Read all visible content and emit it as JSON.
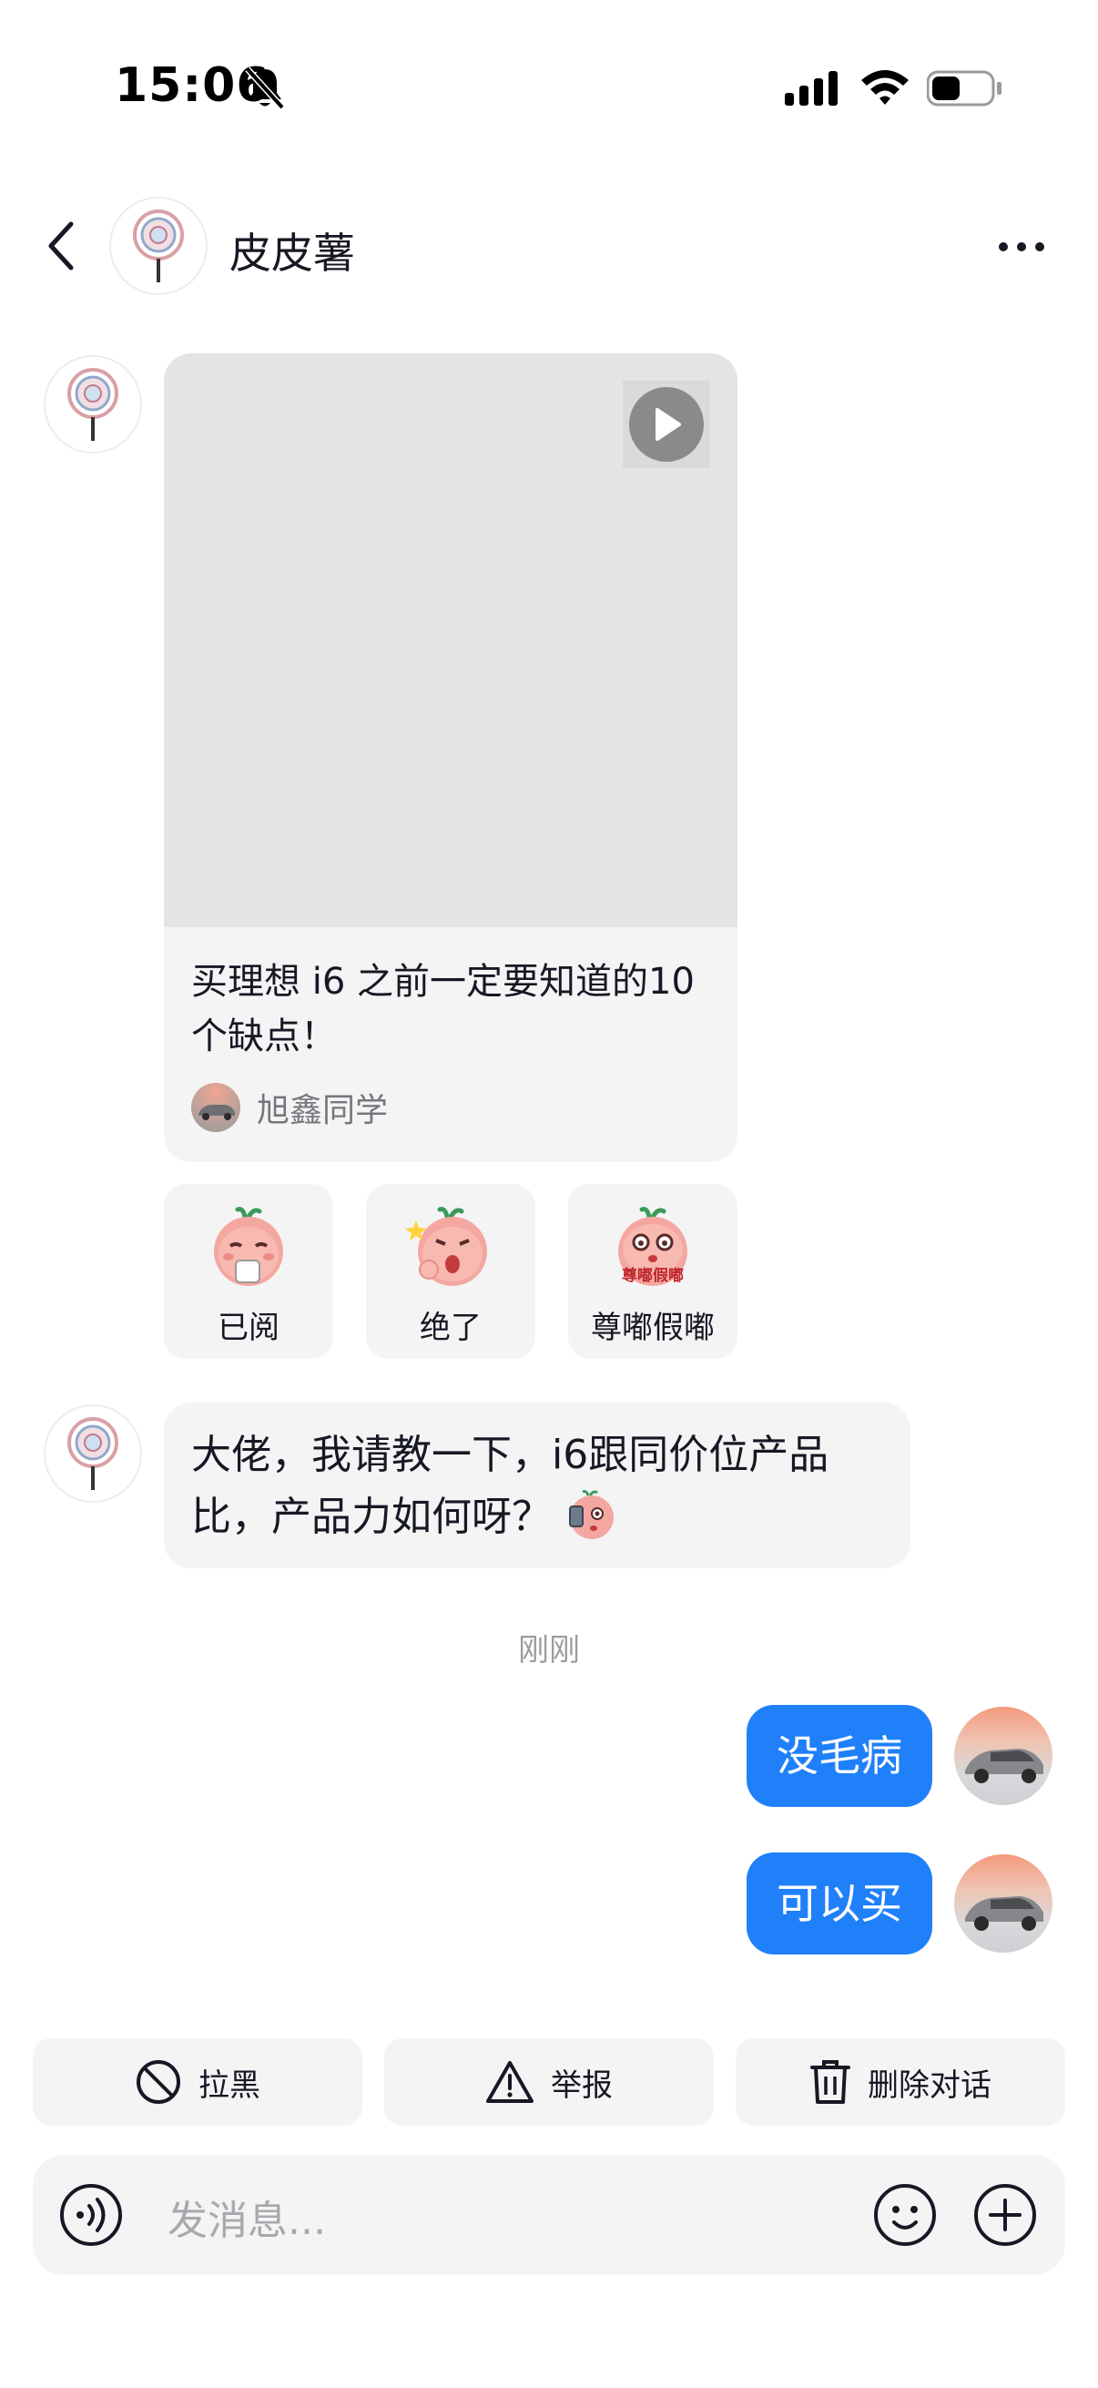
{
  "status_bar": {
    "time": "15:06",
    "icons": [
      "bell-slash-icon",
      "signal-icon",
      "wifi-icon",
      "battery-icon"
    ]
  },
  "header": {
    "contact_name": "皮皮薯",
    "icons": [
      "back-icon",
      "more-icon"
    ]
  },
  "video_card": {
    "title": "买理想 i6 之前一定要知道的10个缺点！",
    "author": "旭鑫同学",
    "icons": [
      "play-icon"
    ]
  },
  "reactions": [
    {
      "label": "已阅"
    },
    {
      "label": "绝了"
    },
    {
      "label": "尊嘟假嘟",
      "sticker_text": "尊嘟假嘟"
    }
  ],
  "received_message": {
    "text": "大佬，我请教一下，i6跟同价位产品比，产品力如何呀？"
  },
  "timestamp": "刚刚",
  "sent_messages": [
    {
      "text": "没毛病"
    },
    {
      "text": "可以买"
    }
  ],
  "actions": [
    {
      "label": "拉黑",
      "icon": "block-icon"
    },
    {
      "label": "举报",
      "icon": "warning-icon"
    },
    {
      "label": "删除对话",
      "icon": "trash-icon"
    }
  ],
  "input_bar": {
    "placeholder": "发消息...",
    "icons": [
      "voice-icon",
      "emoji-icon",
      "plus-icon"
    ]
  },
  "colors": {
    "accent": "#1f80fa",
    "bubble_bg": "#f4f4f5",
    "secondary_text": "#75777d"
  }
}
